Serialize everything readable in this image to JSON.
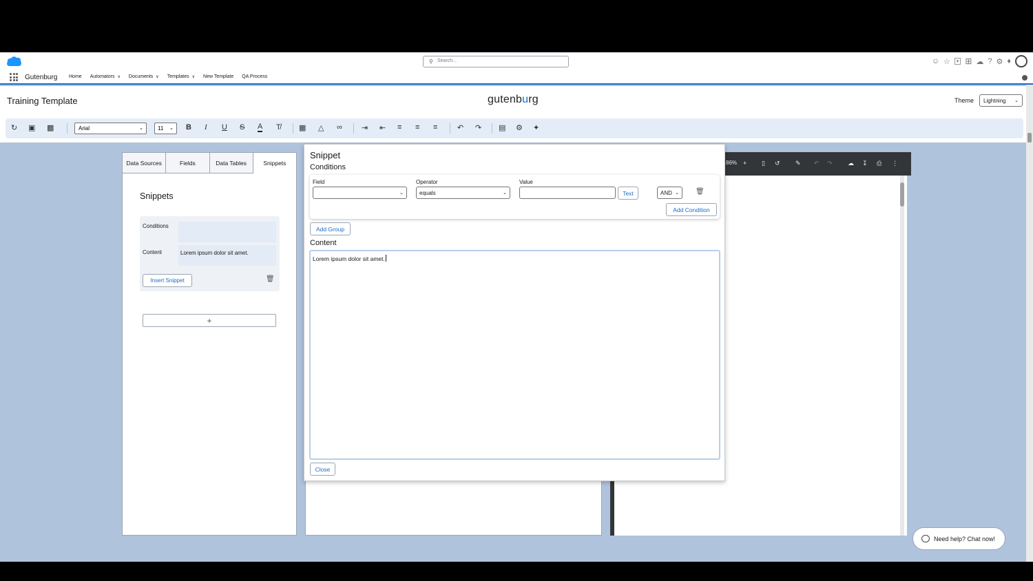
{
  "header": {
    "search_placeholder": "Search...",
    "icons": [
      "assistant-icon",
      "favorite-star-icon",
      "favorites-list-icon",
      "add-icon",
      "trailhead-icon",
      "help-icon",
      "setup-gear-icon",
      "notification-bell-icon",
      "avatar"
    ]
  },
  "nav": {
    "app_name": "Gutenburg",
    "items": [
      {
        "label": "Home",
        "has_menu": false
      },
      {
        "label": "Automators",
        "has_menu": true
      },
      {
        "label": "Documents",
        "has_menu": true
      },
      {
        "label": "Templates",
        "has_menu": true
      },
      {
        "label": "New Template",
        "has_menu": false
      },
      {
        "label": "QA Process",
        "has_menu": false
      }
    ]
  },
  "page": {
    "title": "Training Template",
    "logo_pre": "gutenb",
    "logo_mid": "u",
    "logo_post": "rg",
    "theme_label": "Theme",
    "theme_value": "Lightning"
  },
  "toolbar": {
    "font": "Arial",
    "size": "11"
  },
  "left_panel": {
    "tabs": [
      "Data Sources",
      "Fields",
      "Data Tables",
      "Snippets"
    ],
    "active_tab": "Snippets",
    "heading": "Snippets",
    "card": {
      "conditions_label": "Conditions",
      "conditions_value": "",
      "content_label": "Content",
      "content_value": "Lorem ipsum dolor sit amet.",
      "insert_label": "Insert Snippet"
    },
    "add_label": "+"
  },
  "pdf": {
    "zoom": "86%"
  },
  "modal": {
    "title": "Snippet",
    "conditions_heading": "Conditions",
    "field_label": "Field",
    "field_value": "",
    "operator_label": "Operator",
    "operator_value": "equals",
    "value_label": "Value",
    "value_value": "",
    "text_button": "Text",
    "logic_value": "AND",
    "add_condition": "Add Condition",
    "add_group": "Add Group",
    "content_heading": "Content",
    "content_text": "Lorem ipsum dolor sit amet.",
    "close_label": "Close"
  },
  "chat": {
    "label": "Need help? Chat now!"
  },
  "colors": {
    "brand_blue": "#1b6bc7",
    "page_bg": "#b0c3dd",
    "toolbar_bg": "#e4edf7",
    "pdf_bar": "#323639"
  }
}
